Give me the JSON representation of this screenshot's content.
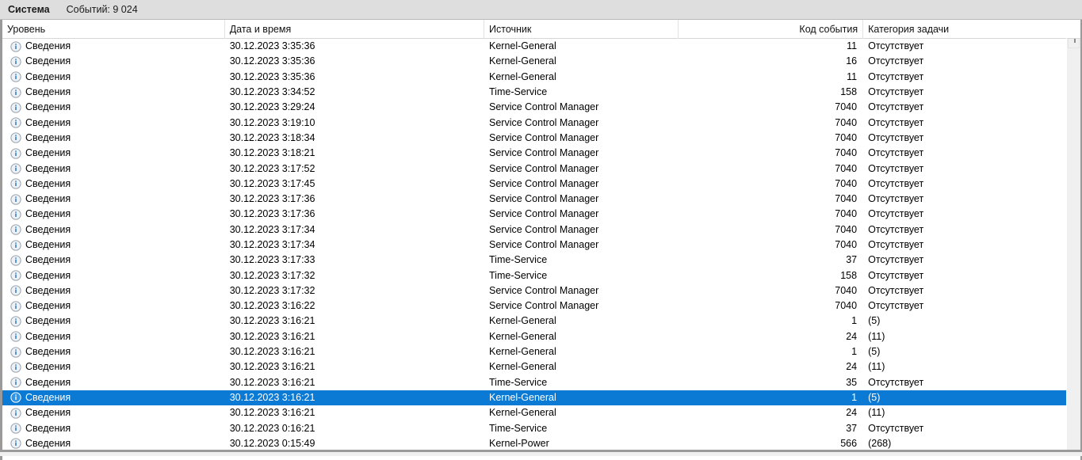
{
  "log_header": {
    "log_name": "Система",
    "event_count_label": "Событий: 9 024"
  },
  "columns": [
    {
      "key": "level",
      "label": "Уровень"
    },
    {
      "key": "datetime",
      "label": "Дата и время"
    },
    {
      "key": "source",
      "label": "Источник"
    },
    {
      "key": "code",
      "label": "Код события"
    },
    {
      "key": "category",
      "label": "Категория задачи"
    }
  ],
  "colors": {
    "selection": "#0a7ad4",
    "header_bar": "#dedede",
    "info_icon_blue": "#1a6fbf"
  },
  "icons": {
    "level_info": "info-icon"
  },
  "rows": [
    {
      "icon": "info-icon",
      "level": "Сведения",
      "datetime": "30.12.2023 3:35:36",
      "source": "Kernel-General",
      "code": "11",
      "category": "Отсутствует",
      "selected": false
    },
    {
      "icon": "info-icon",
      "level": "Сведения",
      "datetime": "30.12.2023 3:35:36",
      "source": "Kernel-General",
      "code": "16",
      "category": "Отсутствует",
      "selected": false
    },
    {
      "icon": "info-icon",
      "level": "Сведения",
      "datetime": "30.12.2023 3:35:36",
      "source": "Kernel-General",
      "code": "11",
      "category": "Отсутствует",
      "selected": false
    },
    {
      "icon": "info-icon",
      "level": "Сведения",
      "datetime": "30.12.2023 3:34:52",
      "source": "Time-Service",
      "code": "158",
      "category": "Отсутствует",
      "selected": false
    },
    {
      "icon": "info-icon",
      "level": "Сведения",
      "datetime": "30.12.2023 3:29:24",
      "source": "Service Control Manager",
      "code": "7040",
      "category": "Отсутствует",
      "selected": false
    },
    {
      "icon": "info-icon",
      "level": "Сведения",
      "datetime": "30.12.2023 3:19:10",
      "source": "Service Control Manager",
      "code": "7040",
      "category": "Отсутствует",
      "selected": false
    },
    {
      "icon": "info-icon",
      "level": "Сведения",
      "datetime": "30.12.2023 3:18:34",
      "source": "Service Control Manager",
      "code": "7040",
      "category": "Отсутствует",
      "selected": false
    },
    {
      "icon": "info-icon",
      "level": "Сведения",
      "datetime": "30.12.2023 3:18:21",
      "source": "Service Control Manager",
      "code": "7040",
      "category": "Отсутствует",
      "selected": false
    },
    {
      "icon": "info-icon",
      "level": "Сведения",
      "datetime": "30.12.2023 3:17:52",
      "source": "Service Control Manager",
      "code": "7040",
      "category": "Отсутствует",
      "selected": false
    },
    {
      "icon": "info-icon",
      "level": "Сведения",
      "datetime": "30.12.2023 3:17:45",
      "source": "Service Control Manager",
      "code": "7040",
      "category": "Отсутствует",
      "selected": false
    },
    {
      "icon": "info-icon",
      "level": "Сведения",
      "datetime": "30.12.2023 3:17:36",
      "source": "Service Control Manager",
      "code": "7040",
      "category": "Отсутствует",
      "selected": false
    },
    {
      "icon": "info-icon",
      "level": "Сведения",
      "datetime": "30.12.2023 3:17:36",
      "source": "Service Control Manager",
      "code": "7040",
      "category": "Отсутствует",
      "selected": false
    },
    {
      "icon": "info-icon",
      "level": "Сведения",
      "datetime": "30.12.2023 3:17:34",
      "source": "Service Control Manager",
      "code": "7040",
      "category": "Отсутствует",
      "selected": false
    },
    {
      "icon": "info-icon",
      "level": "Сведения",
      "datetime": "30.12.2023 3:17:34",
      "source": "Service Control Manager",
      "code": "7040",
      "category": "Отсутствует",
      "selected": false
    },
    {
      "icon": "info-icon",
      "level": "Сведения",
      "datetime": "30.12.2023 3:17:33",
      "source": "Time-Service",
      "code": "37",
      "category": "Отсутствует",
      "selected": false
    },
    {
      "icon": "info-icon",
      "level": "Сведения",
      "datetime": "30.12.2023 3:17:32",
      "source": "Time-Service",
      "code": "158",
      "category": "Отсутствует",
      "selected": false
    },
    {
      "icon": "info-icon",
      "level": "Сведения",
      "datetime": "30.12.2023 3:17:32",
      "source": "Service Control Manager",
      "code": "7040",
      "category": "Отсутствует",
      "selected": false
    },
    {
      "icon": "info-icon",
      "level": "Сведения",
      "datetime": "30.12.2023 3:16:22",
      "source": "Service Control Manager",
      "code": "7040",
      "category": "Отсутствует",
      "selected": false
    },
    {
      "icon": "info-icon",
      "level": "Сведения",
      "datetime": "30.12.2023 3:16:21",
      "source": "Kernel-General",
      "code": "1",
      "category": "(5)",
      "selected": false
    },
    {
      "icon": "info-icon",
      "level": "Сведения",
      "datetime": "30.12.2023 3:16:21",
      "source": "Kernel-General",
      "code": "24",
      "category": "(11)",
      "selected": false
    },
    {
      "icon": "info-icon",
      "level": "Сведения",
      "datetime": "30.12.2023 3:16:21",
      "source": "Kernel-General",
      "code": "1",
      "category": "(5)",
      "selected": false
    },
    {
      "icon": "info-icon",
      "level": "Сведения",
      "datetime": "30.12.2023 3:16:21",
      "source": "Kernel-General",
      "code": "24",
      "category": "(11)",
      "selected": false
    },
    {
      "icon": "info-icon",
      "level": "Сведения",
      "datetime": "30.12.2023 3:16:21",
      "source": "Time-Service",
      "code": "35",
      "category": "Отсутствует",
      "selected": false
    },
    {
      "icon": "info-icon",
      "level": "Сведения",
      "datetime": "30.12.2023 3:16:21",
      "source": "Kernel-General",
      "code": "1",
      "category": "(5)",
      "selected": true
    },
    {
      "icon": "info-icon",
      "level": "Сведения",
      "datetime": "30.12.2023 3:16:21",
      "source": "Kernel-General",
      "code": "24",
      "category": "(11)",
      "selected": false
    },
    {
      "icon": "info-icon",
      "level": "Сведения",
      "datetime": "30.12.2023 0:16:21",
      "source": "Time-Service",
      "code": "37",
      "category": "Отсутствует",
      "selected": false
    },
    {
      "icon": "info-icon",
      "level": "Сведения",
      "datetime": "30.12.2023 0:15:49",
      "source": "Kernel-Power",
      "code": "566",
      "category": "(268)",
      "selected": false
    }
  ],
  "scrollbar": {
    "orientation": "vertical",
    "thumb_position": "top"
  }
}
